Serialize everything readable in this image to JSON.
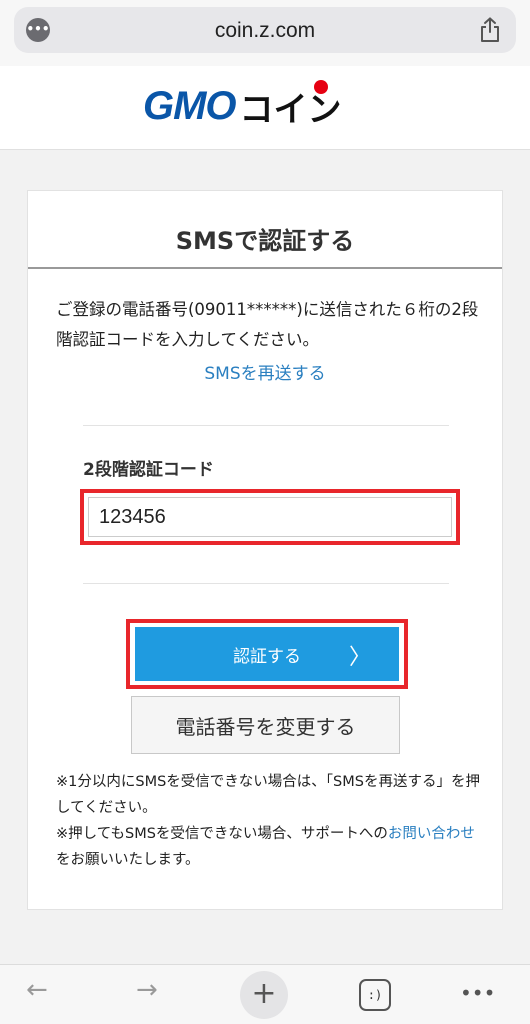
{
  "browser": {
    "url": "coin.z.com",
    "more_icon": "ellipsis-icon",
    "share_icon": "share-icon"
  },
  "logo": {
    "gmo": "GMO",
    "coin": "コイン"
  },
  "card": {
    "title": "SMSで認証する",
    "description": "ご登録の電話番号(09011******)に送信された６桁の2段階認証コードを入力してください。",
    "resend_link": "SMSを再送する",
    "code_label": "2段階認証コード",
    "code_value": "123456",
    "submit_label": "認証する",
    "change_phone_label": "電話番号を変更する",
    "note1": "※1分以内にSMSを受信できない場合は、「SMSを再送する」を押してください。",
    "note2_pre": "※押してもSMSを受信できない場合、サポートへの",
    "note2_link": "お問い合わせ",
    "note2_post": "をお願いいたします。"
  },
  "toolbar": {
    "back": "←",
    "forward": "→",
    "new_tab": "+",
    "tabs": ":)",
    "menu": "•••"
  },
  "colors": {
    "accent_blue": "#1f9be0",
    "link_blue": "#2a7fc0",
    "highlight_red": "#e8262b",
    "logo_blue": "#0a56a8",
    "logo_red": "#e60012"
  }
}
